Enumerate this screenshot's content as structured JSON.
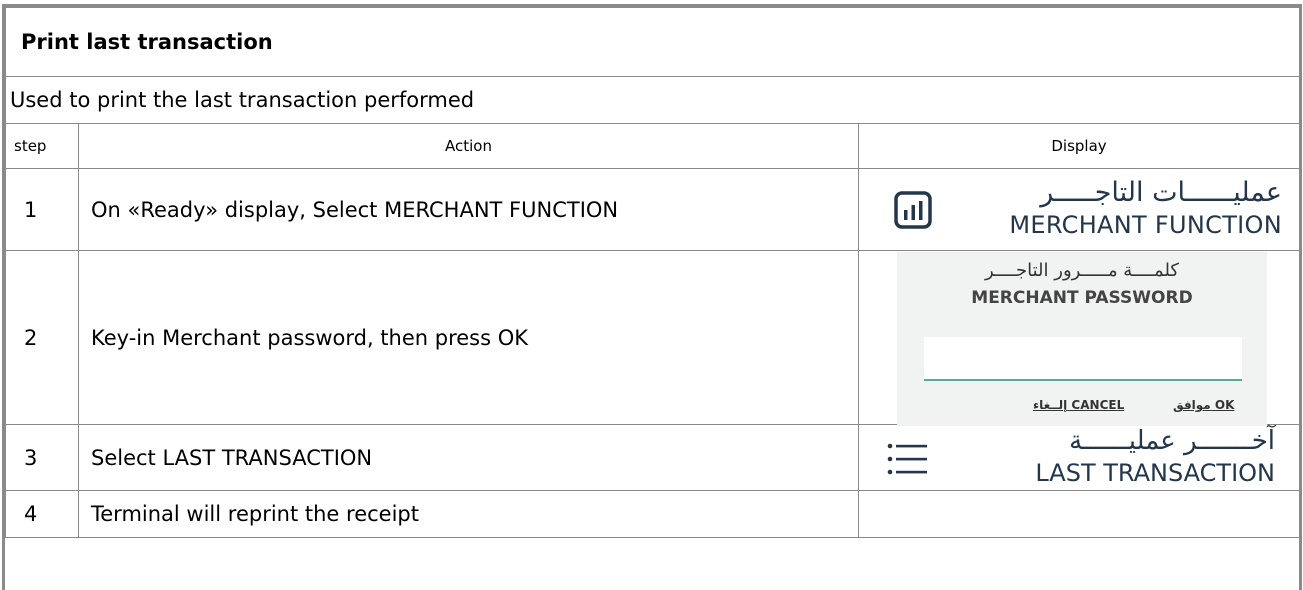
{
  "title": "Print last transaction",
  "description": "Used to print the last transaction performed",
  "headers": {
    "step": "step",
    "action": "Action",
    "display": "Display"
  },
  "steps": [
    {
      "num": "1",
      "action": "On «Ready» display, Select MERCHANT FUNCTION"
    },
    {
      "num": "2",
      "action": "Key-in Merchant password, then press OK"
    },
    {
      "num": "3",
      "action": "Select LAST TRANSACTION"
    },
    {
      "num": "4",
      "action": "Terminal will reprint the receipt"
    }
  ],
  "displays": {
    "merchant_function": {
      "arabic": "عمليــــــات التاجـــــر",
      "english": "MERCHANT FUNCTION",
      "icon": "bar-chart-icon"
    },
    "merchant_password": {
      "arabic": "كلمــــة مـــــرور التاجــــر",
      "english": "MERCHANT PASSWORD",
      "cancel": "إلــغاء CANCEL",
      "ok": "موافق OK"
    },
    "last_transaction": {
      "arabic": "آخـــــــر عمليــــــة",
      "english": "LAST TRANSACTION",
      "icon": "list-icon"
    }
  },
  "colors": {
    "border": "#8a8a8a",
    "icon_text": "#24364a",
    "input_underline": "#5aa896",
    "panel_bg": "#f1f3f2"
  }
}
